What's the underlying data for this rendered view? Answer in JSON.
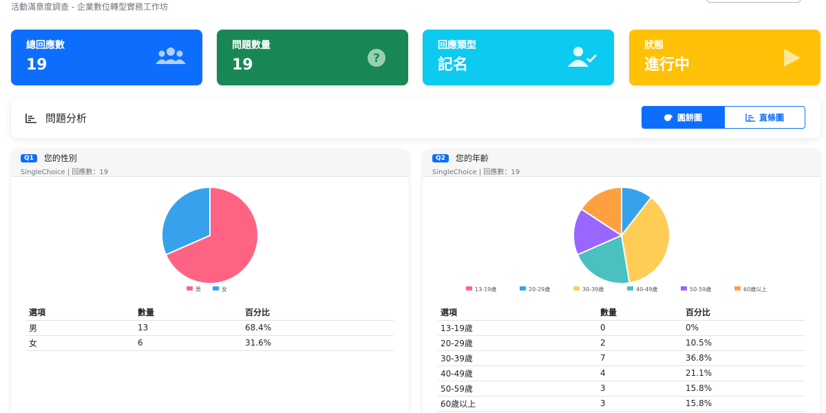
{
  "header": {
    "subtitle": "活動滿意度調查 - 企業數位轉型實務工作坊"
  },
  "stats": [
    {
      "label": "總回應數",
      "value": "19",
      "icon": "users-icon",
      "color": "#0d6efd"
    },
    {
      "label": "問題數量",
      "value": "19",
      "icon": "question-circle-icon",
      "color": "#198754"
    },
    {
      "label": "回應類型",
      "value": "記名",
      "icon": "user-check-icon",
      "color": "#0dcaf0"
    },
    {
      "label": "狀態",
      "value": "進行中",
      "icon": "play-icon",
      "color": "#ffc107"
    }
  ],
  "analysis": {
    "title": "問題分析",
    "pie_label": "圓餅圖",
    "bar_label": "直條圖"
  },
  "questions": [
    {
      "badge": "Q1",
      "title": "您的性別",
      "meta": "SingleChoice | 回應數：19",
      "table_headers": [
        "選項",
        "數量",
        "百分比"
      ],
      "rows": [
        {
          "option": "男",
          "count": "13",
          "percent": "68.4%"
        },
        {
          "option": "女",
          "count": "6",
          "percent": "31.6%"
        }
      ]
    },
    {
      "badge": "Q2",
      "title": "您的年齡",
      "meta": "SingleChoice | 回應數：19",
      "table_headers": [
        "選項",
        "數量",
        "百分比"
      ],
      "rows": [
        {
          "option": "13-19歲",
          "count": "0",
          "percent": "0%"
        },
        {
          "option": "20-29歲",
          "count": "2",
          "percent": "10.5%"
        },
        {
          "option": "30-39歲",
          "count": "7",
          "percent": "36.8%"
        },
        {
          "option": "40-49歲",
          "count": "4",
          "percent": "21.1%"
        },
        {
          "option": "50-59歲",
          "count": "3",
          "percent": "15.8%"
        },
        {
          "option": "60歲以上",
          "count": "3",
          "percent": "15.8%"
        }
      ]
    }
  ],
  "chart_data": [
    {
      "type": "pie",
      "categories": [
        "男",
        "女"
      ],
      "values": [
        13,
        6
      ],
      "colors": [
        "#ff6384",
        "#36a2eb"
      ],
      "legend": "bottom"
    },
    {
      "type": "pie",
      "categories": [
        "13-19歲",
        "20-29歲",
        "30-39歲",
        "40-49歲",
        "50-59歲",
        "60歲以上"
      ],
      "values": [
        0,
        2,
        7,
        4,
        3,
        3
      ],
      "colors": [
        "#ff6384",
        "#36a2eb",
        "#ffcd56",
        "#4bc0c0",
        "#9966ff",
        "#ff9f40"
      ],
      "legend": "bottom"
    }
  ]
}
